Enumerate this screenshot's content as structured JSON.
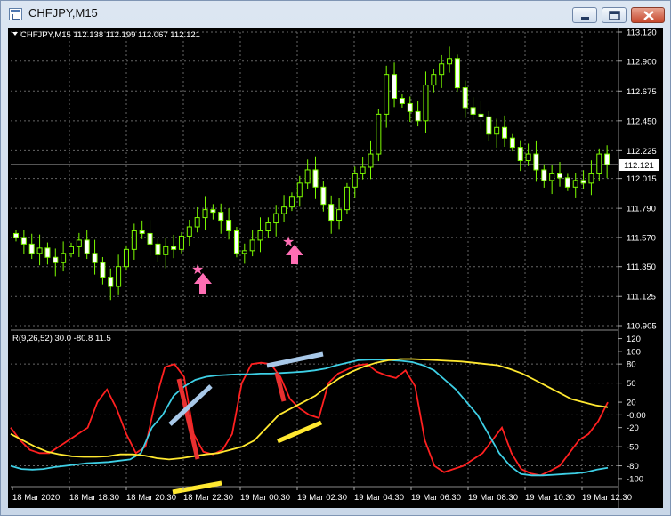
{
  "window": {
    "title": "CHFJPY,M15",
    "buttons": {
      "minimize": "minimize-icon",
      "maximize": "maximize-icon",
      "close": "close-icon"
    }
  },
  "main_chart": {
    "label": "CHFJPY,M15  112.138 112.199 112.067 112.121",
    "y_ticks": [
      "113.120",
      "112.900",
      "112.675",
      "112.450",
      "112.225",
      "112.015",
      "111.790",
      "111.570",
      "111.350",
      "111.125",
      "110.905"
    ],
    "current_price": "112.121",
    "colors": {
      "candle": "#7CFC00",
      "bull_body": "#000000",
      "bear_body": "#FFFFFF",
      "grid": "#888888",
      "arrow": "#FF6EB4"
    }
  },
  "indicator": {
    "label": "R(9,26,52) 30.0 -80.8 11.5",
    "y_ticks": [
      "120",
      "100",
      "80",
      "50",
      "20",
      "-0.00",
      "-20",
      "-50",
      "-80",
      "-100"
    ],
    "colors": {
      "red": "#FF2020",
      "cyan": "#3ED0E6",
      "yellow": "#FFE830",
      "note_blue": "#A8C8E8"
    }
  },
  "x_axis": {
    "labels": [
      "18 Mar 2020",
      "18 Mar 18:30",
      "18 Mar 20:30",
      "18 Mar 22:30",
      "19 Mar 00:30",
      "19 Mar 02:30",
      "19 Mar 04:30",
      "19 Mar 06:30",
      "19 Mar 08:30",
      "19 Mar 10:30",
      "19 Mar 12:30"
    ]
  },
  "chart_data": [
    {
      "type": "candlestick",
      "symbol": "CHFJPY",
      "timeframe": "M15",
      "ylim": [
        110.905,
        113.12
      ],
      "last_price": 112.121,
      "ohlc_of_last_bar": {
        "open": 112.138,
        "high": 112.199,
        "low": 112.067,
        "close": 112.121
      },
      "close_series": [
        111.57,
        111.52,
        111.45,
        111.49,
        111.42,
        111.38,
        111.45,
        111.5,
        111.55,
        111.45,
        111.38,
        111.27,
        111.2,
        111.35,
        111.48,
        111.62,
        111.6,
        111.52,
        111.44,
        111.5,
        111.48,
        111.58,
        111.65,
        111.72,
        111.78,
        111.76,
        111.7,
        111.62,
        111.45,
        111.47,
        111.55,
        111.62,
        111.68,
        111.75,
        111.8,
        111.88,
        111.98,
        112.08,
        111.95,
        111.82,
        111.7,
        111.78,
        111.95,
        112.05,
        112.1,
        112.2,
        112.5,
        112.8,
        112.62,
        112.58,
        112.52,
        112.45,
        112.72,
        112.8,
        112.88,
        112.92,
        112.7,
        112.55,
        112.5,
        112.48,
        112.35,
        112.4,
        112.32,
        112.25,
        112.15,
        112.2,
        112.08,
        112.0,
        112.05,
        112.02,
        111.95,
        112.0,
        111.98,
        112.05,
        112.2,
        112.12
      ]
    },
    {
      "type": "line",
      "title": "R(9,26,52) 30.0 -80.8 11.5",
      "ylim": [
        -110,
        125
      ],
      "series": [
        {
          "name": "",
          "color": "#FF2020",
          "values": [
            -20,
            -40,
            -55,
            -60,
            -60,
            -50,
            -40,
            -30,
            -20,
            20,
            40,
            10,
            -30,
            -60,
            -50,
            20,
            75,
            80,
            60,
            -30,
            -58,
            -62,
            -55,
            -30,
            50,
            80,
            82,
            80,
            60,
            25,
            10,
            0,
            -5,
            50,
            65,
            72,
            78,
            80,
            68,
            62,
            58,
            70,
            45,
            -40,
            -80,
            -90,
            -85,
            -80,
            -70,
            -60,
            -40,
            -20,
            -60,
            -85,
            -92,
            -95,
            -88,
            -80,
            -60,
            -40,
            -30,
            -10,
            20
          ]
        },
        {
          "name": "",
          "color": "#3ED0E6",
          "values": [
            -80,
            -85,
            -86,
            -85,
            -82,
            -80,
            -78,
            -76,
            -75,
            -74,
            -72,
            -70,
            -60,
            -20,
            0,
            30,
            45,
            55,
            60,
            62,
            63,
            64,
            64,
            65,
            65,
            66,
            67,
            68,
            70,
            73,
            78,
            82,
            86,
            87,
            87,
            86,
            85,
            83,
            78,
            70,
            55,
            40,
            20,
            0,
            -30,
            -60,
            -80,
            -93,
            -95,
            -95,
            -94,
            -93,
            -92,
            -90,
            -86,
            -83
          ]
        },
        {
          "name": "",
          "color": "#FFE830",
          "values": [
            -30,
            -40,
            -50,
            -58,
            -62,
            -65,
            -66,
            -66,
            -65,
            -62,
            -62,
            -64,
            -68,
            -70,
            -68,
            -65,
            -62,
            -60,
            -55,
            -50,
            -40,
            -20,
            0,
            10,
            20,
            30,
            45,
            58,
            68,
            76,
            82,
            86,
            88,
            88,
            87,
            86,
            85,
            84,
            82,
            80,
            78,
            72,
            65,
            55,
            45,
            35,
            25,
            20,
            15,
            12
          ]
        }
      ]
    }
  ]
}
